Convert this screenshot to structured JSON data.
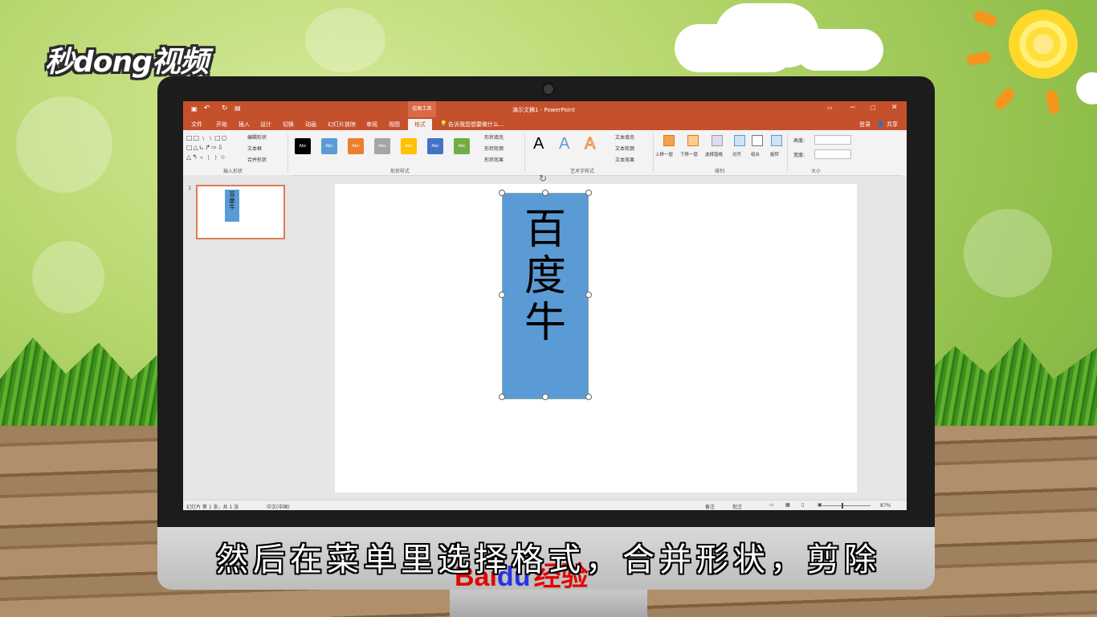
{
  "logo": "秒dong视频",
  "window": {
    "title": "演示文稿1 - PowerPoint",
    "context_tab": "绘图工具",
    "login": "登录",
    "share": "共享"
  },
  "tabs": [
    "文件",
    "开始",
    "插入",
    "设计",
    "切换",
    "动画",
    "幻灯片放映",
    "审阅",
    "视图",
    "格式"
  ],
  "active_tab": "格式",
  "tell_me": "告诉我您想要做什么...",
  "ribbon": {
    "insert_shapes": {
      "label": "插入形状",
      "edit_shape": "编辑形状",
      "text_box": "文本框",
      "merge_shapes": "合并形状"
    },
    "shape_styles": {
      "label": "形状样式",
      "swatch_text": "Abc",
      "fill": "形状填充",
      "outline": "形状轮廓",
      "effects": "形状效果",
      "swatch_colors": [
        "#000000",
        "#5b9bd5",
        "#ed7d31",
        "#a5a5a5",
        "#ffc000",
        "#4472c4",
        "#70ad47"
      ]
    },
    "wordart": {
      "label": "艺术字样式",
      "sample": "A",
      "text_fill": "文本填充",
      "text_outline": "文本轮廓",
      "text_effects": "文本效果"
    },
    "arrange": {
      "label": "排列",
      "bring_forward": "上移一层",
      "send_backward": "下移一层",
      "selection_pane": "选择窗格",
      "align": "对齐",
      "group": "组合",
      "rotate": "旋转"
    },
    "size": {
      "label": "大小",
      "height": "高度:",
      "width": "宽度:"
    }
  },
  "slide_number": "1",
  "shape_text": [
    "百",
    "度",
    "牛"
  ],
  "status": {
    "slide_info": "幻灯片 第 1 张，共 1 张",
    "language": "中文(中国)",
    "notes": "备注",
    "comments": "批注",
    "zoom": "87%"
  },
  "subtitle": "然后在菜单里选择格式，合并形状，剪除",
  "watermark": {
    "bai": "Bai",
    "du": "du",
    "jingyan": "经验"
  }
}
